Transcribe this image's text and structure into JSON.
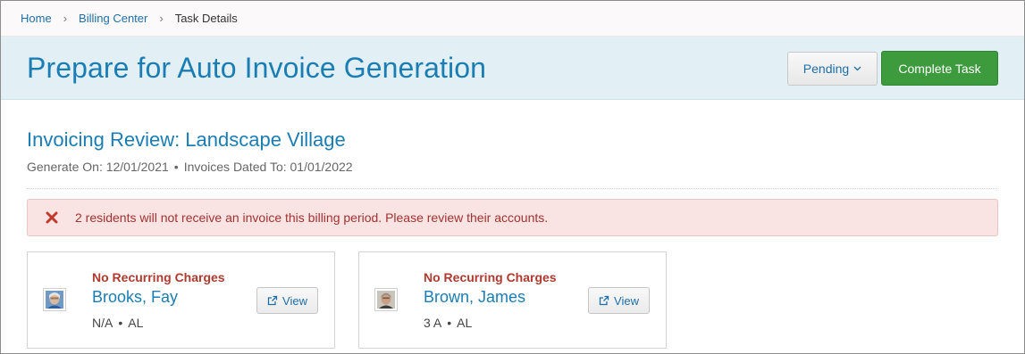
{
  "breadcrumb": {
    "items": [
      "Home",
      "Billing Center"
    ],
    "current": "Task Details",
    "separator": "›"
  },
  "header": {
    "title": "Prepare for Auto Invoice Generation",
    "status_label": "Pending",
    "status_caret": "⌄",
    "complete_label": "Complete Task"
  },
  "review": {
    "title": "Invoicing Review: Landscape Village",
    "generate_on_label": "Generate On: 12/01/2021",
    "dated_to_label": "Invoices Dated To: 01/01/2022",
    "bullet": "•"
  },
  "alert": {
    "icon": "✖",
    "message": "2 residents will not receive an invoice this billing period. Please review their accounts."
  },
  "residents": [
    {
      "flag": "No Recurring Charges",
      "name": "Brooks, Fay",
      "unit": "N/A",
      "care_level": "AL",
      "view_label": "View"
    },
    {
      "flag": "No Recurring Charges",
      "name": "Brown, James",
      "unit": "3 A",
      "care_level": "AL",
      "view_label": "View"
    }
  ],
  "colors": {
    "link": "#1e6fa8",
    "title": "#1a7db3",
    "header_bg": "#e2f0f6",
    "success": "#3d9a3d",
    "danger": "#b03a2e",
    "alert_bg": "#f9e3e3"
  }
}
